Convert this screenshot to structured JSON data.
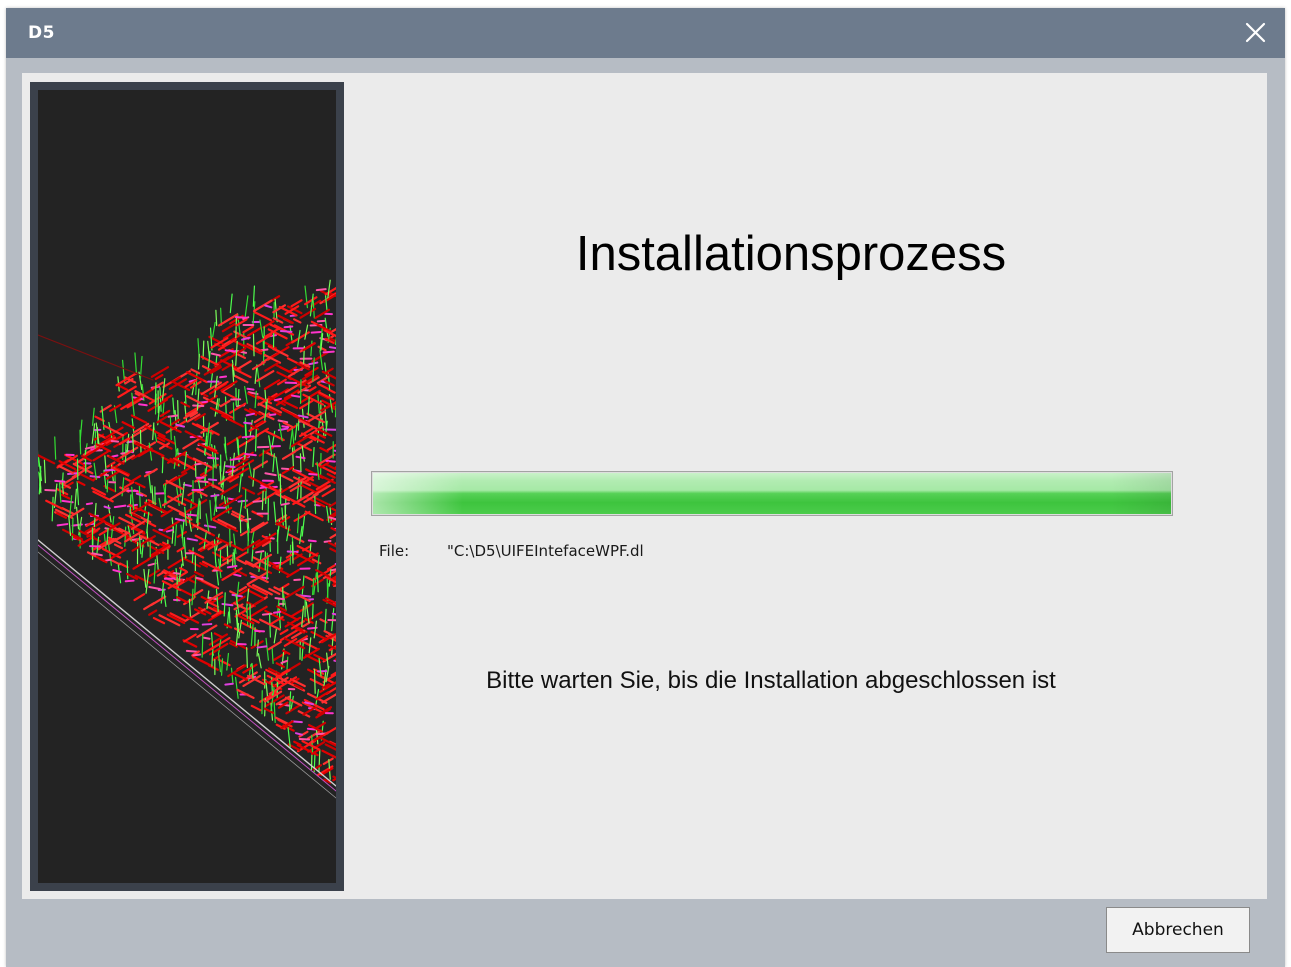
{
  "window": {
    "title": "D5",
    "close_icon": "close-icon"
  },
  "main": {
    "heading": "Installationsprozess",
    "progress": {
      "value_percent": 100,
      "color": "#4fcd4f"
    },
    "file_label": "File:",
    "file_path": "\"C:\\D5\\UIFEIntefaceWPF.dl",
    "wait_message": "Bitte warten Sie, bis die Installation abgeschlossen ist"
  },
  "footer": {
    "cancel_label": "Abbrechen"
  },
  "colors": {
    "titlebar": "#6d7b8d",
    "window_frame": "#b6bcc4",
    "content_bg": "#ebebeb",
    "side_panel_frame": "#3b414b",
    "side_panel_bg": "#232323"
  }
}
